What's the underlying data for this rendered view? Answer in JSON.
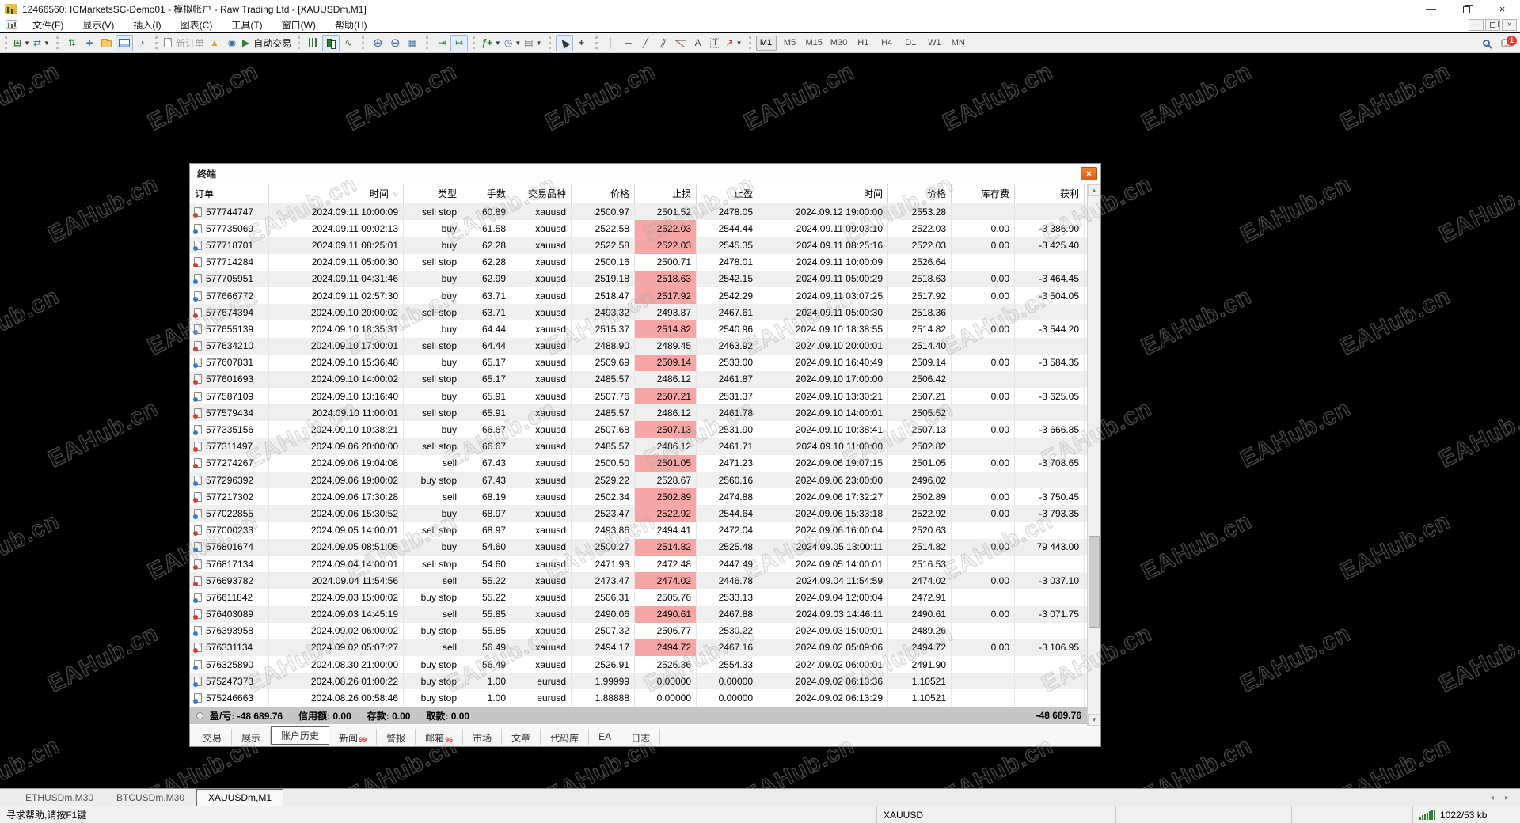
{
  "window": {
    "title": "12466560: ICMarketsSC-Demo01 - 模拟帐户 - Raw Trading Ltd - [XAUUSDm,M1]"
  },
  "menu": {
    "items": [
      "文件(F)",
      "显示(V)",
      "插入(I)",
      "图表(C)",
      "工具(T)",
      "窗口(W)",
      "帮助(H)"
    ]
  },
  "toolbar": {
    "new_order_label": "新订单",
    "autotrading_label": "自动交易",
    "timeframes": [
      "M1",
      "M5",
      "M15",
      "M30",
      "H1",
      "H4",
      "D1",
      "W1",
      "MN"
    ],
    "active_timeframe": "M1",
    "notification_count": "1"
  },
  "watermark": {
    "text": "EAHub.cn"
  },
  "terminal": {
    "title": "终端",
    "columns": [
      "订单",
      "时间",
      "类型",
      "手数",
      "交易品种",
      "价格",
      "止损",
      "止盈",
      "时间",
      "价格",
      "库存费",
      "获利"
    ],
    "sort_column_index": 1,
    "sort_glyph": "▽",
    "rows": [
      {
        "order": "577744747",
        "open_time": "2024.09.11 10:00:09",
        "type": "sell stop",
        "lots": "60.89",
        "symbol": "xauusd",
        "open_price": "2500.97",
        "sl": "2501.52",
        "sl_hl": false,
        "tp": "2478.05",
        "close_time": "2024.09.12 19:00:00",
        "close_price": "2553.28",
        "swap": "",
        "profit": ""
      },
      {
        "order": "577735069",
        "open_time": "2024.09.11 09:02:13",
        "type": "buy",
        "lots": "61.58",
        "symbol": "xauusd",
        "open_price": "2522.58",
        "sl": "2522.03",
        "sl_hl": true,
        "tp": "2544.44",
        "close_time": "2024.09.11 09:03:10",
        "close_price": "2522.03",
        "swap": "0.00",
        "profit": "-3 386.90"
      },
      {
        "order": "577718701",
        "open_time": "2024.09.11 08:25:01",
        "type": "buy",
        "lots": "62.28",
        "symbol": "xauusd",
        "open_price": "2522.58",
        "sl": "2522.03",
        "sl_hl": true,
        "tp": "2545.35",
        "close_time": "2024.09.11 08:25:16",
        "close_price": "2522.03",
        "swap": "0.00",
        "profit": "-3 425.40"
      },
      {
        "order": "577714284",
        "open_time": "2024.09.11 05:00:30",
        "type": "sell stop",
        "lots": "62.28",
        "symbol": "xauusd",
        "open_price": "2500.16",
        "sl": "2500.71",
        "sl_hl": false,
        "tp": "2478.01",
        "close_time": "2024.09.11 10:00:09",
        "close_price": "2526.64",
        "swap": "",
        "profit": ""
      },
      {
        "order": "577705951",
        "open_time": "2024.09.11 04:31:46",
        "type": "buy",
        "lots": "62.99",
        "symbol": "xauusd",
        "open_price": "2519.18",
        "sl": "2518.63",
        "sl_hl": true,
        "tp": "2542.15",
        "close_time": "2024.09.11 05:00:29",
        "close_price": "2518.63",
        "swap": "0.00",
        "profit": "-3 464.45"
      },
      {
        "order": "577666772",
        "open_time": "2024.09.11 02:57:30",
        "type": "buy",
        "lots": "63.71",
        "symbol": "xauusd",
        "open_price": "2518.47",
        "sl": "2517.92",
        "sl_hl": true,
        "tp": "2542.29",
        "close_time": "2024.09.11 03:07:25",
        "close_price": "2517.92",
        "swap": "0.00",
        "profit": "-3 504.05"
      },
      {
        "order": "577674394",
        "open_time": "2024.09.10 20:00:02",
        "type": "sell stop",
        "lots": "63.71",
        "symbol": "xauusd",
        "open_price": "2493.32",
        "sl": "2493.87",
        "sl_hl": false,
        "tp": "2467.61",
        "close_time": "2024.09.11 05:00:30",
        "close_price": "2518.36",
        "swap": "",
        "profit": ""
      },
      {
        "order": "577655139",
        "open_time": "2024.09.10 18:35:31",
        "type": "buy",
        "lots": "64.44",
        "symbol": "xauusd",
        "open_price": "2515.37",
        "sl": "2514.82",
        "sl_hl": true,
        "tp": "2540.96",
        "close_time": "2024.09.10 18:38:55",
        "close_price": "2514.82",
        "swap": "0.00",
        "profit": "-3 544.20"
      },
      {
        "order": "577634210",
        "open_time": "2024.09.10 17:00:01",
        "type": "sell stop",
        "lots": "64.44",
        "symbol": "xauusd",
        "open_price": "2488.90",
        "sl": "2489.45",
        "sl_hl": false,
        "tp": "2463.92",
        "close_time": "2024.09.10 20:00:01",
        "close_price": "2514.40",
        "swap": "",
        "profit": ""
      },
      {
        "order": "577607831",
        "open_time": "2024.09.10 15:36:48",
        "type": "buy",
        "lots": "65.17",
        "symbol": "xauusd",
        "open_price": "2509.69",
        "sl": "2509.14",
        "sl_hl": true,
        "tp": "2533.00",
        "close_time": "2024.09.10 16:40:49",
        "close_price": "2509.14",
        "swap": "0.00",
        "profit": "-3 584.35"
      },
      {
        "order": "577601693",
        "open_time": "2024.09.10 14:00:02",
        "type": "sell stop",
        "lots": "65.17",
        "symbol": "xauusd",
        "open_price": "2485.57",
        "sl": "2486.12",
        "sl_hl": false,
        "tp": "2461.87",
        "close_time": "2024.09.10 17:00:00",
        "close_price": "2506.42",
        "swap": "",
        "profit": ""
      },
      {
        "order": "577587109",
        "open_time": "2024.09.10 13:16:40",
        "type": "buy",
        "lots": "65.91",
        "symbol": "xauusd",
        "open_price": "2507.76",
        "sl": "2507.21",
        "sl_hl": true,
        "tp": "2531.37",
        "close_time": "2024.09.10 13:30:21",
        "close_price": "2507.21",
        "swap": "0.00",
        "profit": "-3 625.05"
      },
      {
        "order": "577579434",
        "open_time": "2024.09.10 11:00:01",
        "type": "sell stop",
        "lots": "65.91",
        "symbol": "xauusd",
        "open_price": "2485.57",
        "sl": "2486.12",
        "sl_hl": false,
        "tp": "2461.78",
        "close_time": "2024.09.10 14:00:01",
        "close_price": "2505.52",
        "swap": "",
        "profit": ""
      },
      {
        "order": "577335156",
        "open_time": "2024.09.10 10:38:21",
        "type": "buy",
        "lots": "66.67",
        "symbol": "xauusd",
        "open_price": "2507.68",
        "sl": "2507.13",
        "sl_hl": true,
        "tp": "2531.90",
        "close_time": "2024.09.10 10:38:41",
        "close_price": "2507.13",
        "swap": "0.00",
        "profit": "-3 666.85"
      },
      {
        "order": "577311497",
        "open_time": "2024.09.06 20:00:00",
        "type": "sell stop",
        "lots": "66.67",
        "symbol": "xauusd",
        "open_price": "2485.57",
        "sl": "2486.12",
        "sl_hl": false,
        "tp": "2461.71",
        "close_time": "2024.09.10 11:00:00",
        "close_price": "2502.82",
        "swap": "",
        "profit": ""
      },
      {
        "order": "577274267",
        "open_time": "2024.09.06 19:04:08",
        "type": "sell",
        "lots": "67.43",
        "symbol": "xauusd",
        "open_price": "2500.50",
        "sl": "2501.05",
        "sl_hl": true,
        "tp": "2471.23",
        "close_time": "2024.09.06 19:07:15",
        "close_price": "2501.05",
        "swap": "0.00",
        "profit": "-3 708.65"
      },
      {
        "order": "577296392",
        "open_time": "2024.09.06 19:00:02",
        "type": "buy stop",
        "lots": "67.43",
        "symbol": "xauusd",
        "open_price": "2529.22",
        "sl": "2528.67",
        "sl_hl": false,
        "tp": "2560.16",
        "close_time": "2024.09.06 23:00:00",
        "close_price": "2496.02",
        "swap": "",
        "profit": ""
      },
      {
        "order": "577217302",
        "open_time": "2024.09.06 17:30:28",
        "type": "sell",
        "lots": "68.19",
        "symbol": "xauusd",
        "open_price": "2502.34",
        "sl": "2502.89",
        "sl_hl": true,
        "tp": "2474.88",
        "close_time": "2024.09.06 17:32:27",
        "close_price": "2502.89",
        "swap": "0.00",
        "profit": "-3 750.45"
      },
      {
        "order": "577022855",
        "open_time": "2024.09.06 15:30:52",
        "type": "buy",
        "lots": "68.97",
        "symbol": "xauusd",
        "open_price": "2523.47",
        "sl": "2522.92",
        "sl_hl": true,
        "tp": "2544.64",
        "close_time": "2024.09.06 15:33:18",
        "close_price": "2522.92",
        "swap": "0.00",
        "profit": "-3 793.35"
      },
      {
        "order": "577000233",
        "open_time": "2024.09.05 14:00:01",
        "type": "sell stop",
        "lots": "68.97",
        "symbol": "xauusd",
        "open_price": "2493.86",
        "sl": "2494.41",
        "sl_hl": false,
        "tp": "2472.04",
        "close_time": "2024.09.06 16:00:04",
        "close_price": "2520.63",
        "swap": "",
        "profit": ""
      },
      {
        "order": "576801674",
        "open_time": "2024.09.05 08:51:05",
        "type": "buy",
        "lots": "54.60",
        "symbol": "xauusd",
        "open_price": "2500.27",
        "sl": "2514.82",
        "sl_hl": true,
        "tp": "2525.48",
        "close_time": "2024.09.05 13:00:11",
        "close_price": "2514.82",
        "swap": "0.00",
        "profit": "79 443.00"
      },
      {
        "order": "576817134",
        "open_time": "2024.09.04 14:00:01",
        "type": "sell stop",
        "lots": "54.60",
        "symbol": "xauusd",
        "open_price": "2471.93",
        "sl": "2472.48",
        "sl_hl": false,
        "tp": "2447.49",
        "close_time": "2024.09.05 14:00:01",
        "close_price": "2516.53",
        "swap": "",
        "profit": ""
      },
      {
        "order": "576693782",
        "open_time": "2024.09.04 11:54:56",
        "type": "sell",
        "lots": "55.22",
        "symbol": "xauusd",
        "open_price": "2473.47",
        "sl": "2474.02",
        "sl_hl": true,
        "tp": "2446.78",
        "close_time": "2024.09.04 11:54:59",
        "close_price": "2474.02",
        "swap": "0.00",
        "profit": "-3 037.10"
      },
      {
        "order": "576611842",
        "open_time": "2024.09.03 15:00:02",
        "type": "buy stop",
        "lots": "55.22",
        "symbol": "xauusd",
        "open_price": "2506.31",
        "sl": "2505.76",
        "sl_hl": false,
        "tp": "2533.13",
        "close_time": "2024.09.04 12:00:04",
        "close_price": "2472.91",
        "swap": "",
        "profit": ""
      },
      {
        "order": "576403089",
        "open_time": "2024.09.03 14:45:19",
        "type": "sell",
        "lots": "55.85",
        "symbol": "xauusd",
        "open_price": "2490.06",
        "sl": "2490.61",
        "sl_hl": true,
        "tp": "2467.88",
        "close_time": "2024.09.03 14:46:11",
        "close_price": "2490.61",
        "swap": "0.00",
        "profit": "-3 071.75"
      },
      {
        "order": "576393958",
        "open_time": "2024.09.02 06:00:02",
        "type": "buy stop",
        "lots": "55.85",
        "symbol": "xauusd",
        "open_price": "2507.32",
        "sl": "2506.77",
        "sl_hl": false,
        "tp": "2530.22",
        "close_time": "2024.09.03 15:00:01",
        "close_price": "2489.26",
        "swap": "",
        "profit": ""
      },
      {
        "order": "576331134",
        "open_time": "2024.09.02 05:07:27",
        "type": "sell",
        "lots": "56.49",
        "symbol": "xauusd",
        "open_price": "2494.17",
        "sl": "2494.72",
        "sl_hl": true,
        "tp": "2467.16",
        "close_time": "2024.09.02 05:09:06",
        "close_price": "2494.72",
        "swap": "0.00",
        "profit": "-3 106.95"
      },
      {
        "order": "576325890",
        "open_time": "2024.08.30 21:00:00",
        "type": "buy stop",
        "lots": "56.49",
        "symbol": "xauusd",
        "open_price": "2526.91",
        "sl": "2526.36",
        "sl_hl": false,
        "tp": "2554.33",
        "close_time": "2024.09.02 06:00:01",
        "close_price": "2491.90",
        "swap": "",
        "profit": ""
      },
      {
        "order": "575247373",
        "open_time": "2024.08.26 01:00:22",
        "type": "buy stop",
        "lots": "1.00",
        "symbol": "eurusd",
        "open_price": "1.99999",
        "sl": "0.00000",
        "sl_hl": false,
        "tp": "0.00000",
        "close_time": "2024.09.02 06:13:36",
        "close_price": "1.10521",
        "swap": "",
        "profit": ""
      },
      {
        "order": "575246663",
        "open_time": "2024.08.26 00:58:46",
        "type": "buy stop",
        "lots": "1.00",
        "symbol": "eurusd",
        "open_price": "1.88888",
        "sl": "0.00000",
        "sl_hl": false,
        "tp": "0.00000",
        "close_time": "2024.09.02 06:13:29",
        "close_price": "1.10521",
        "swap": "",
        "profit": ""
      }
    ],
    "footer": {
      "items": [
        "盈/亏: -48 689.76",
        "信用额: 0.00",
        "存款: 0.00",
        "取款: 0.00"
      ],
      "total": "-48 689.76"
    },
    "tabs": [
      {
        "label": "交易",
        "badge": "",
        "active": false
      },
      {
        "label": "展示",
        "badge": "",
        "active": false
      },
      {
        "label": "账户历史",
        "badge": "",
        "active": true
      },
      {
        "label": "新闻",
        "badge": "99",
        "active": false
      },
      {
        "label": "警报",
        "badge": "",
        "active": false
      },
      {
        "label": "邮箱",
        "badge": "96",
        "active": false
      },
      {
        "label": "市场",
        "badge": "",
        "active": false
      },
      {
        "label": "文章",
        "badge": "",
        "active": false
      },
      {
        "label": "代码库",
        "badge": "",
        "active": false
      },
      {
        "label": "EA",
        "badge": "",
        "active": false
      },
      {
        "label": "日志",
        "badge": "",
        "active": false
      }
    ]
  },
  "chart_tabs": [
    {
      "label": "ETHUSDm,M30",
      "active": false
    },
    {
      "label": "BTCUSDm,M30",
      "active": false
    },
    {
      "label": "XAUUSDm,M1",
      "active": true
    }
  ],
  "status_bar": {
    "help": "寻求帮助,请按F1键",
    "symbol": "XAUUSD",
    "traffic": "1022/53 kb"
  },
  "colors": {
    "sl_highlight": "#f7a6a6",
    "buy_dot": "#2f7bd6",
    "sell_dot": "#d0402e",
    "terminal_close": "#e8701a",
    "badge_red": "#e03c31"
  }
}
